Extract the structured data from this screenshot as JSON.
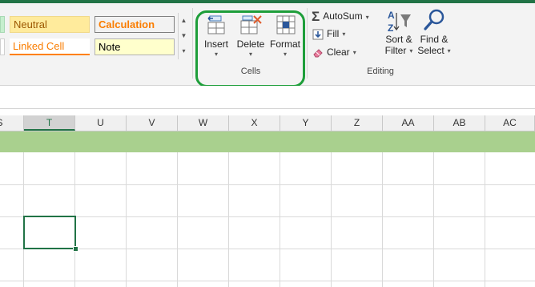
{
  "ribbon": {
    "styles": {
      "neutral": "Neutral",
      "linked_cell": "Linked Cell",
      "calculation": "Calculation",
      "note": "Note"
    },
    "cells_group": {
      "label": "Cells",
      "insert": "Insert",
      "delete": "Delete",
      "format": "Format"
    },
    "editing_group": {
      "label": "Editing",
      "autosum": "AutoSum",
      "fill": "Fill",
      "clear": "Clear",
      "sort_filter_line1": "Sort &",
      "sort_filter_line2": "Filter",
      "find_select_line1": "Find &",
      "find_select_line2": "Select"
    }
  },
  "grid": {
    "column_headers": [
      "S",
      "T",
      "U",
      "V",
      "W",
      "X",
      "Y",
      "Z",
      "AA",
      "AB",
      "AC"
    ],
    "active_column": "T"
  },
  "colors": {
    "accent": "#217346",
    "highlight_border": "#1e9e3a",
    "band_fill": "#a9d08e"
  }
}
